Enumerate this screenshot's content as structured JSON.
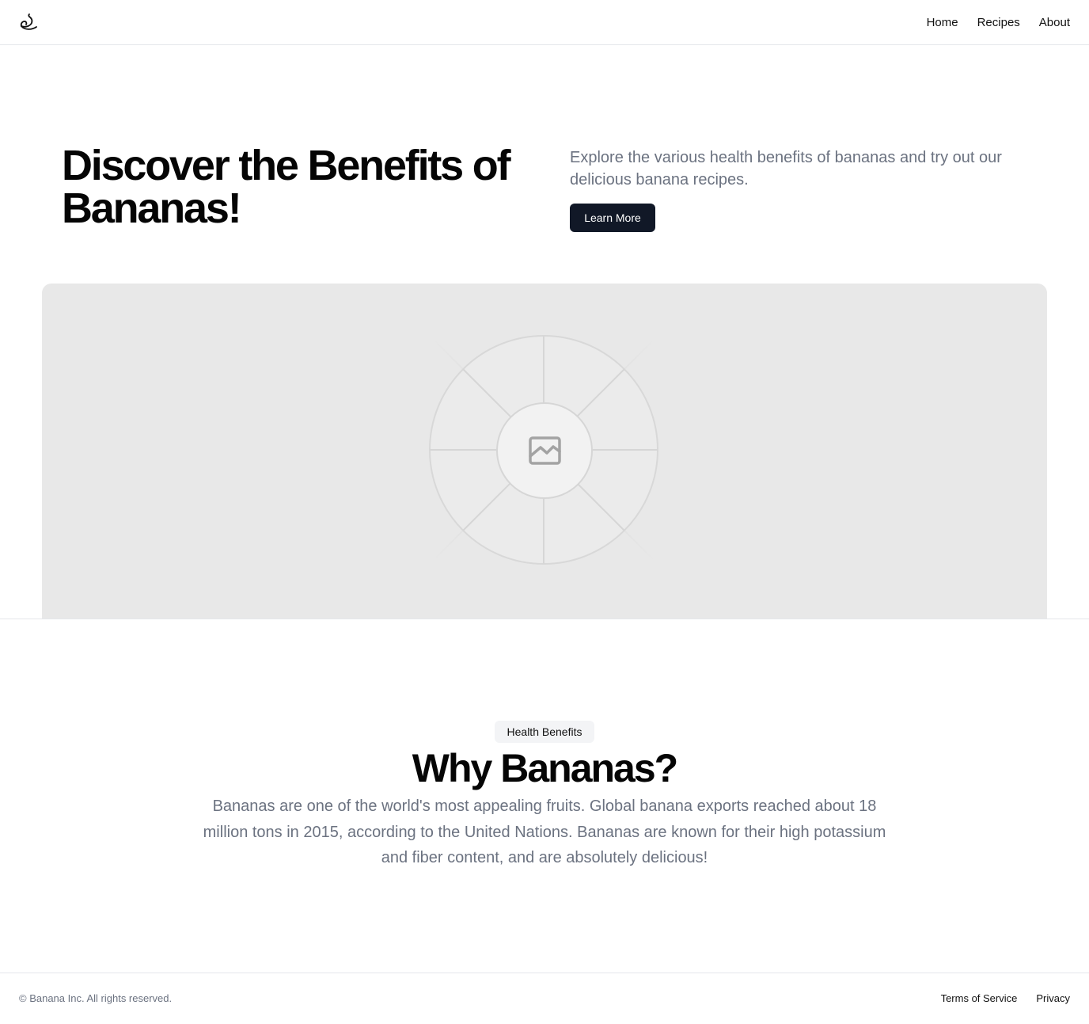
{
  "header": {
    "logo_icon": "banana-logo-icon",
    "nav": [
      "Home",
      "Recipes",
      "About"
    ]
  },
  "hero": {
    "title": "Discover the Benefits of Bananas!",
    "subtitle": "Explore the various health benefits of bananas and try out our delicious banana recipes.",
    "button_label": "Learn More",
    "image_icon": "image-placeholder-icon"
  },
  "benefits": {
    "badge": "Health Benefits",
    "title": "Why Bananas?",
    "body": "Bananas are one of the world's most appealing fruits. Global banana exports reached about 18 million tons in 2015, according to the United Nations. Bananas are known for their high potassium and fiber content, and are absolutely delicious!"
  },
  "footer": {
    "copyright": "© Banana Inc. All rights reserved.",
    "links": [
      "Terms of Service",
      "Privacy"
    ]
  },
  "colors": {
    "primary_button": "#111827",
    "muted_text": "#6b7280",
    "badge_bg": "#f3f4f6",
    "placeholder_bg": "#e8e8e8"
  }
}
